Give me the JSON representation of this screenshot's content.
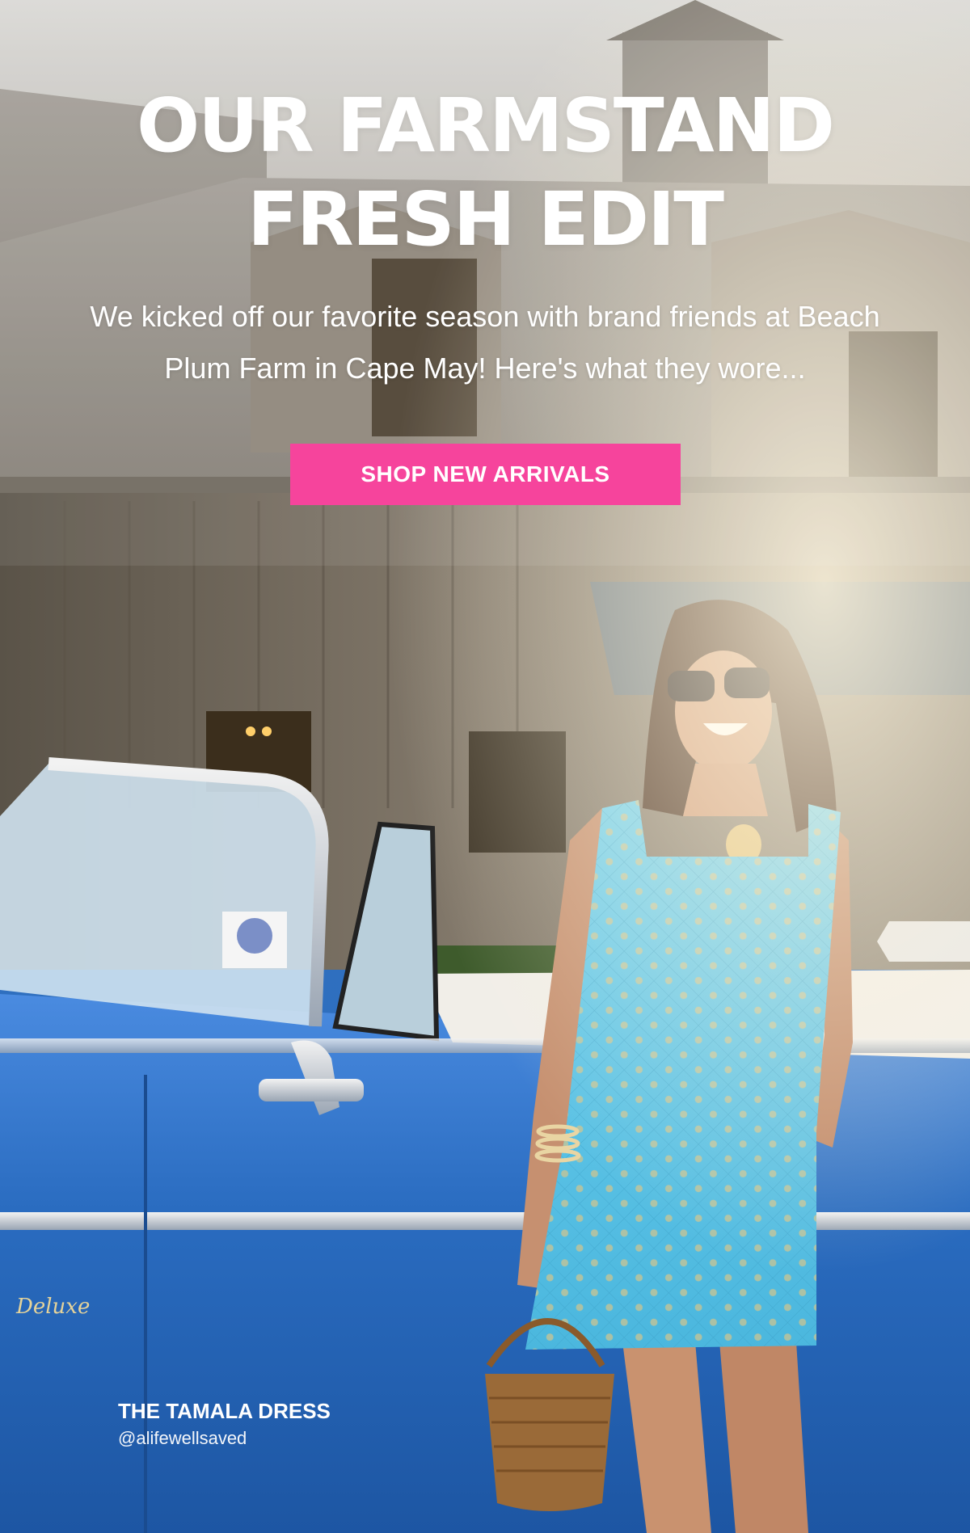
{
  "hero": {
    "headline_line1": "OUR FARMSTAND",
    "headline_line2": "FRESH EDIT",
    "subtitle": "We kicked off our favorite season with brand friends at Beach Plum Farm in Cape May! Here's what they wore...",
    "cta_label": "SHOP NEW ARRIVALS",
    "image_alt": "Woman in turquoise sequin dress leaning on a blue vintage convertible in front of a wooden farm barn"
  },
  "caption": {
    "product": "THE TAMALA DRESS",
    "handle": "@alifewellsaved"
  },
  "colors": {
    "accent": "#f6449c",
    "text": "#ffffff",
    "car_blue": "#2a6cc0",
    "dress_turquoise": "#5cc4e6"
  }
}
